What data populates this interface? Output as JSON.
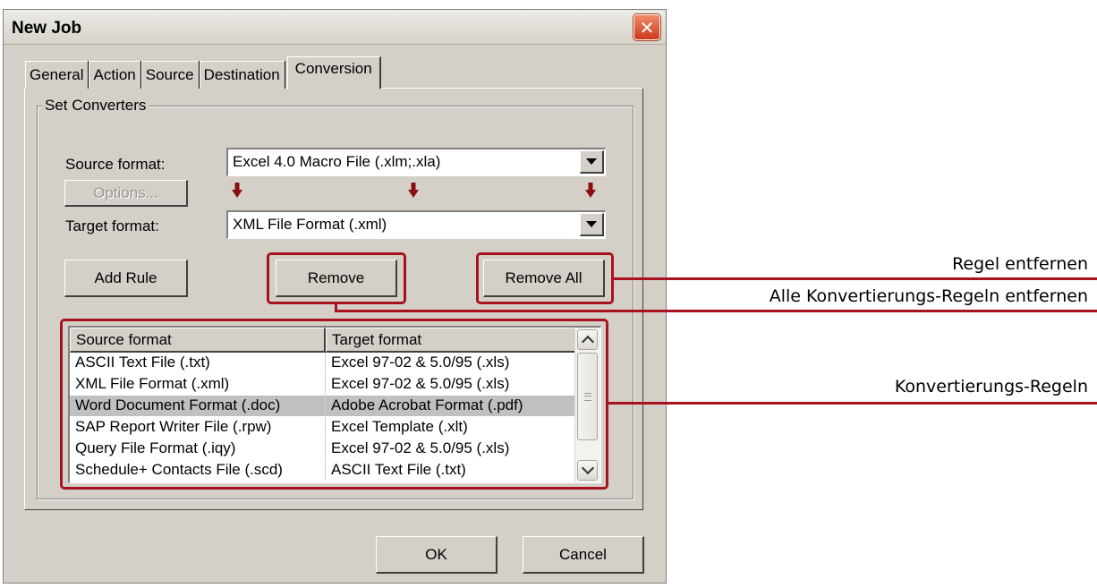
{
  "window": {
    "title": "New Job",
    "close_symbol": "✕"
  },
  "tabs": [
    {
      "label": "General"
    },
    {
      "label": "Action"
    },
    {
      "label": "Source"
    },
    {
      "label": "Destination"
    },
    {
      "label": "Conversion",
      "active": true
    }
  ],
  "group": {
    "label": "Set Converters"
  },
  "source": {
    "label": "Source format:",
    "value": "Excel 4.0 Macro File (.xlm;.xla)"
  },
  "options_button": {
    "label": "Options...",
    "enabled": false
  },
  "target": {
    "label": "Target format:",
    "value": "XML File Format (.xml)"
  },
  "buttons": {
    "add_rule": "Add Rule",
    "remove": "Remove",
    "remove_all": "Remove All",
    "ok": "OK",
    "cancel": "Cancel"
  },
  "rules_table": {
    "columns": [
      "Source format",
      "Target format"
    ],
    "rows": [
      {
        "source": "ASCII Text File (.txt)",
        "target": "Excel 97-02 & 5.0/95 (.xls)"
      },
      {
        "source": "XML File Format (.xml)",
        "target": "Excel 97-02 & 5.0/95 (.xls)"
      },
      {
        "source": "Word Document Format (.doc)",
        "target": "Adobe Acrobat Format (.pdf)",
        "selected": true
      },
      {
        "source": "SAP Report Writer File (.rpw)",
        "target": "Excel Template (.xlt)"
      },
      {
        "source": "Query File Format (.iqy)",
        "target": "Excel 97-02 & 5.0/95 (.xls)"
      },
      {
        "source": "Schedule+ Contacts File (.scd)",
        "target": "ASCII Text File (.txt)"
      }
    ]
  },
  "annotations": {
    "remove_all": "Regel entfernen",
    "remove": "Alle Konvertierungs-Regeln entfernen",
    "rules": "Konvertierungs-Regeln"
  },
  "colors": {
    "highlight": "#a8121f",
    "dialog_face": "#d4d0c8",
    "selected_row": "#c0c0c0"
  }
}
